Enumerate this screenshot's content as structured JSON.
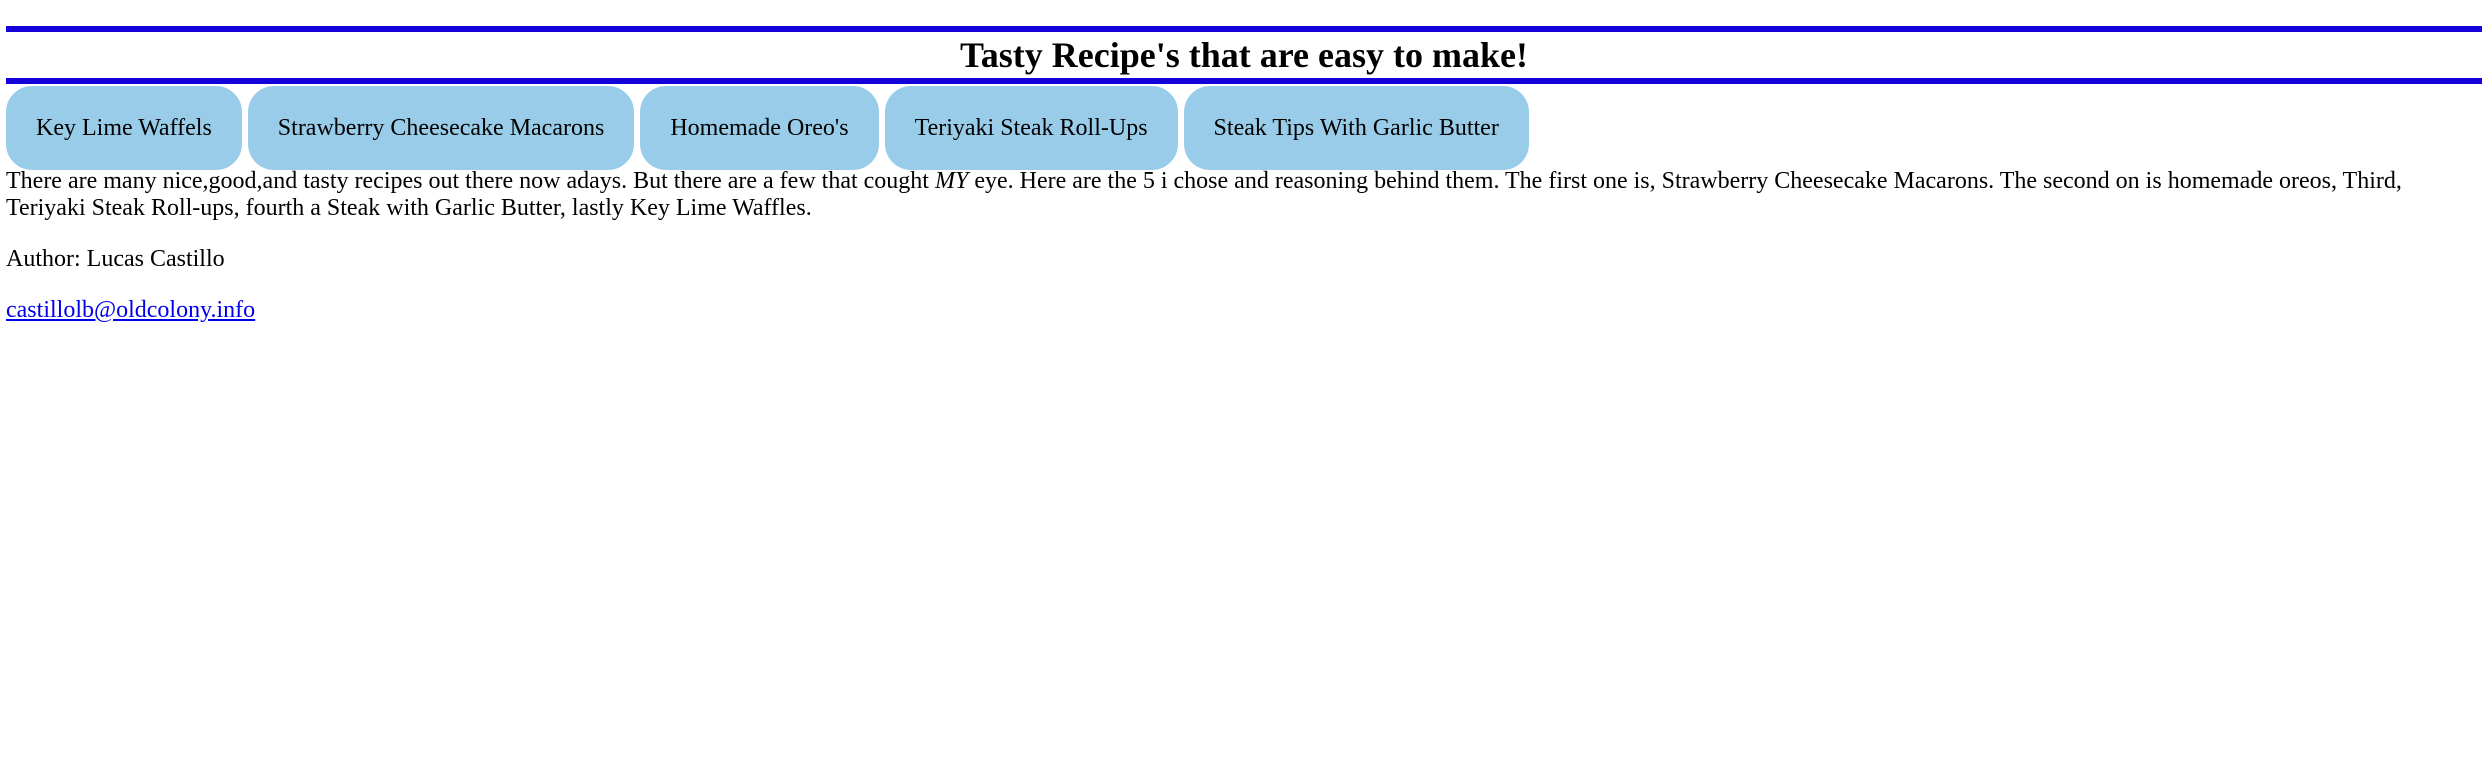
{
  "header": {
    "title": "Tasty Recipe's that are easy to make!"
  },
  "nav": {
    "items": [
      {
        "label": "Key Lime Waffels"
      },
      {
        "label": "Strawberry Cheesecake Macarons"
      },
      {
        "label": "Homemade Oreo's"
      },
      {
        "label": "Teriyaki Steak Roll-Ups"
      },
      {
        "label": "Steak Tips With Garlic Butter"
      }
    ]
  },
  "intro": {
    "before": "There are many nice,good,and tasty recipes out there now adays. But there are a few that cought ",
    "emphasis": "MY",
    "after": " eye. Here are the 5 i chose and reasoning behind them. The first one is, Strawberry Cheesecake Macarons. The second on is homemade oreos, Third, Teriyaki Steak Roll-ups, fourth a Steak with Garlic Butter, lastly Key Lime Waffles."
  },
  "author": {
    "text": "Author: Lucas Castillo"
  },
  "contact": {
    "email": "castillolb@oldcolony.info"
  },
  "colors": {
    "rule": "#1400d9",
    "nav_button_bg": "#99cce8",
    "link": "#0000ee"
  }
}
